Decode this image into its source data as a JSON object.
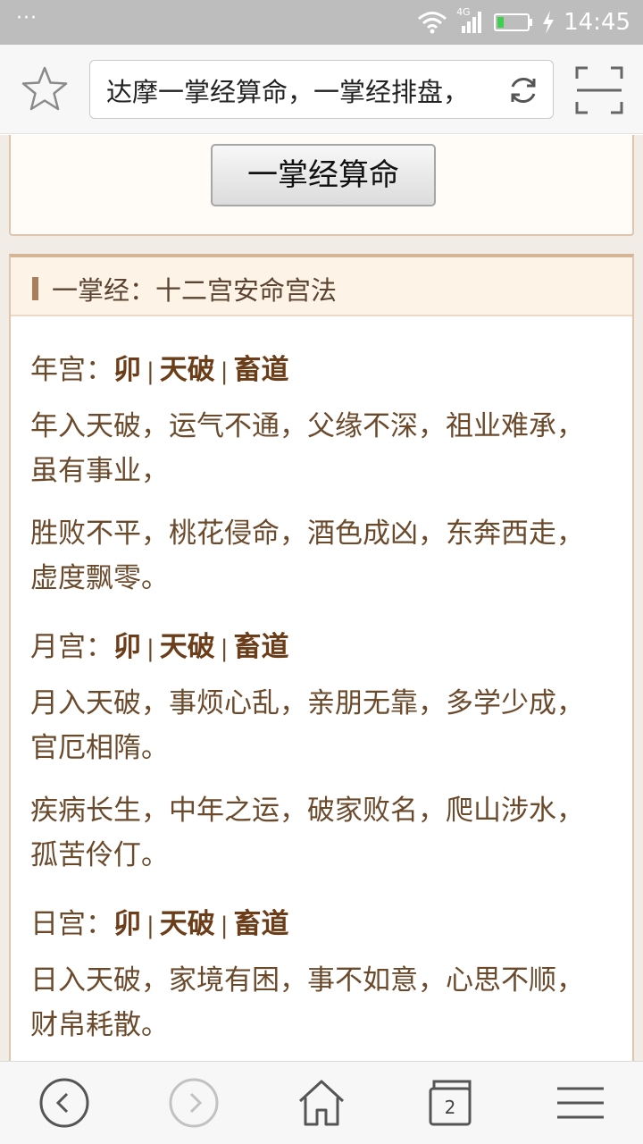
{
  "status_bar": {
    "dots": "···",
    "network": "4G",
    "time": "14:45",
    "icons": [
      "wifi-icon",
      "signal-icon",
      "battery-icon",
      "charging-icon"
    ]
  },
  "browser": {
    "url_text": "达摩一掌经算命，一掌经排盘，",
    "icons": [
      "star-icon",
      "reload-icon",
      "scan-icon"
    ]
  },
  "top_card": {
    "button_label": "一掌经算命"
  },
  "section": {
    "title": "一掌经：十二宫安命宫法",
    "palaces": [
      {
        "label": "年宫：",
        "branch": "卯",
        "star": "天破",
        "path": "畜道",
        "paragraphs": [
          "年入天破，运气不通，父缘不深，祖业难承，虽有事业，",
          "胜败不平，桃花侵命，酒色成凶，东奔西走，虚度飘零。"
        ]
      },
      {
        "label": "月宫：",
        "branch": "卯",
        "star": "天破",
        "path": "畜道",
        "paragraphs": [
          "月入天破，事烦心乱，亲朋无靠，多学少成，官厄相隋。",
          "疾病长生，中年之运，破家败名，爬山涉水，孤苦伶仃。"
        ]
      },
      {
        "label": "日宫：",
        "branch": "卯",
        "star": "天破",
        "path": "畜道",
        "paragraphs": [
          "日入天破，家境有困，事不如意，心思不顺，财帛耗散。"
        ]
      }
    ],
    "separator": "|"
  },
  "bottom_nav": {
    "tab_count": "2",
    "icons": [
      "back-icon",
      "forward-icon",
      "home-icon",
      "tabs-icon",
      "menu-icon"
    ]
  },
  "colors": {
    "accent_text": "#6b4a2c",
    "header_bg": "#fdf3e6",
    "border": "#dcc6b0"
  }
}
